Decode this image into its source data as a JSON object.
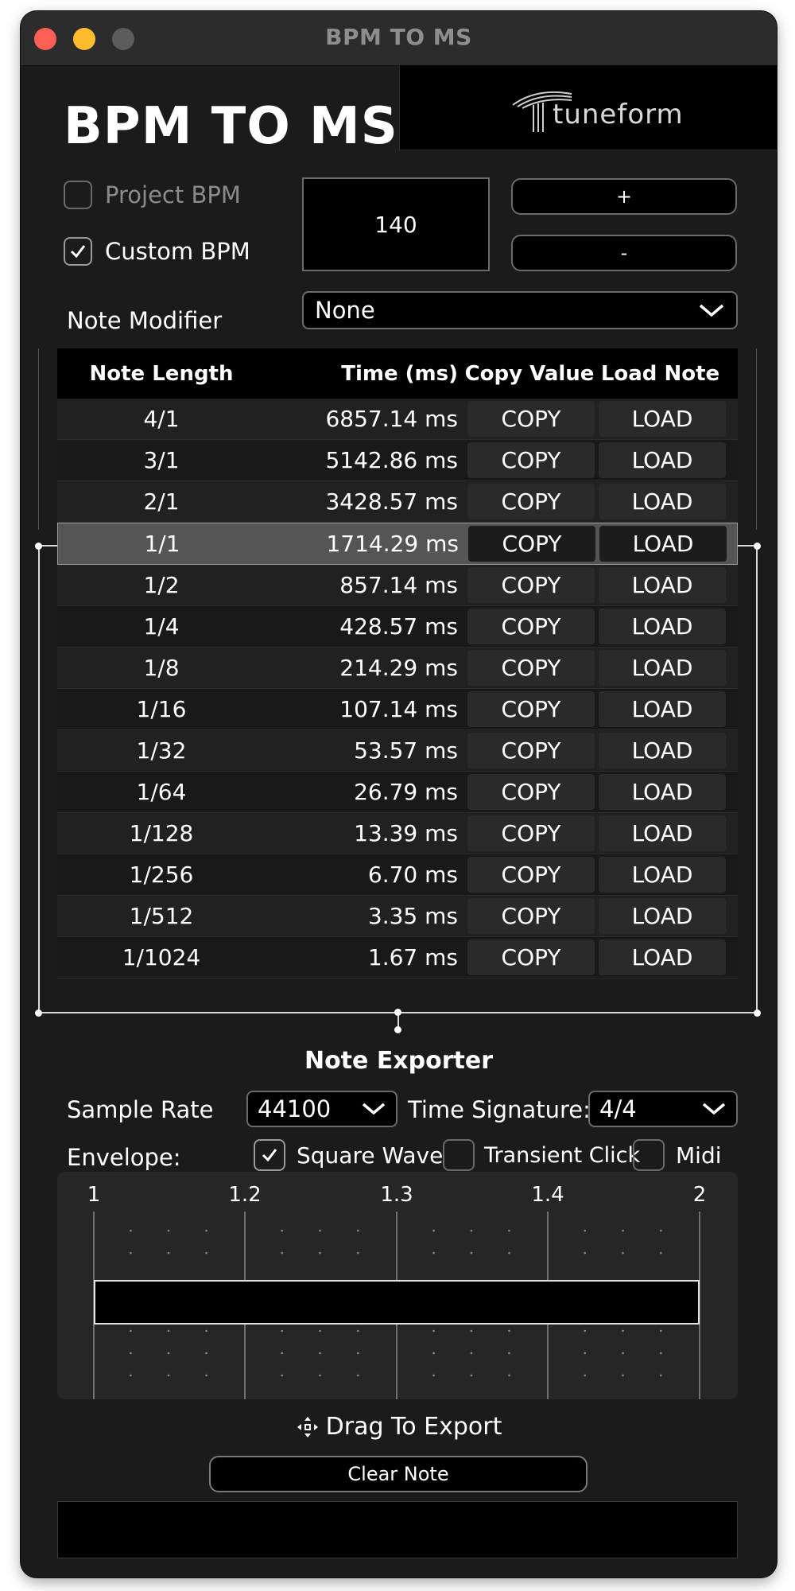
{
  "window": {
    "title": "BPM TO MS"
  },
  "header": {
    "app_title": "BPM TO MS",
    "brand_name": "tuneform"
  },
  "bpm": {
    "project_label": "Project BPM",
    "project_checked": false,
    "custom_label": "Custom BPM",
    "custom_checked": true,
    "value": "140",
    "plus_label": "+",
    "minus_label": "-"
  },
  "modifier": {
    "label": "Note Modifier",
    "value": "None"
  },
  "table": {
    "headers": [
      "Note Length",
      "Time (ms)",
      "Copy Value",
      "Load Note"
    ],
    "copy_label": "COPY",
    "load_label": "LOAD",
    "selected_index": 3,
    "rows": [
      {
        "note": "4/1",
        "time": "6857.14 ms"
      },
      {
        "note": "3/1",
        "time": "5142.86 ms"
      },
      {
        "note": "2/1",
        "time": "3428.57 ms"
      },
      {
        "note": "1/1",
        "time": "1714.29 ms"
      },
      {
        "note": "1/2",
        "time": "857.14 ms"
      },
      {
        "note": "1/4",
        "time": "428.57 ms"
      },
      {
        "note": "1/8",
        "time": "214.29 ms"
      },
      {
        "note": "1/16",
        "time": "107.14 ms"
      },
      {
        "note": "1/32",
        "time": "53.57 ms"
      },
      {
        "note": "1/64",
        "time": "26.79 ms"
      },
      {
        "note": "1/128",
        "time": "13.39 ms"
      },
      {
        "note": "1/256",
        "time": "6.70 ms"
      },
      {
        "note": "1/512",
        "time": "3.35 ms"
      },
      {
        "note": "1/1024",
        "time": "1.67 ms"
      }
    ]
  },
  "exporter": {
    "title": "Note Exporter",
    "sample_rate_label": "Sample Rate",
    "sample_rate_value": "44100",
    "time_sig_label": "Time Signature:",
    "time_sig_value": "4/4",
    "envelope_label": "Envelope:",
    "options": [
      {
        "label": "Square Wave",
        "checked": true
      },
      {
        "label": "Transient Click",
        "checked": false
      },
      {
        "label": "Midi",
        "checked": false
      }
    ],
    "timeline_labels": [
      "1",
      "1.2",
      "1.3",
      "1.4",
      "2"
    ],
    "drag_label": "Drag To Export",
    "clear_label": "Clear Note"
  },
  "colors": {
    "window_bg": "#1b1b1b",
    "selected_row": "#555555",
    "accent_white": "#ffffff"
  }
}
